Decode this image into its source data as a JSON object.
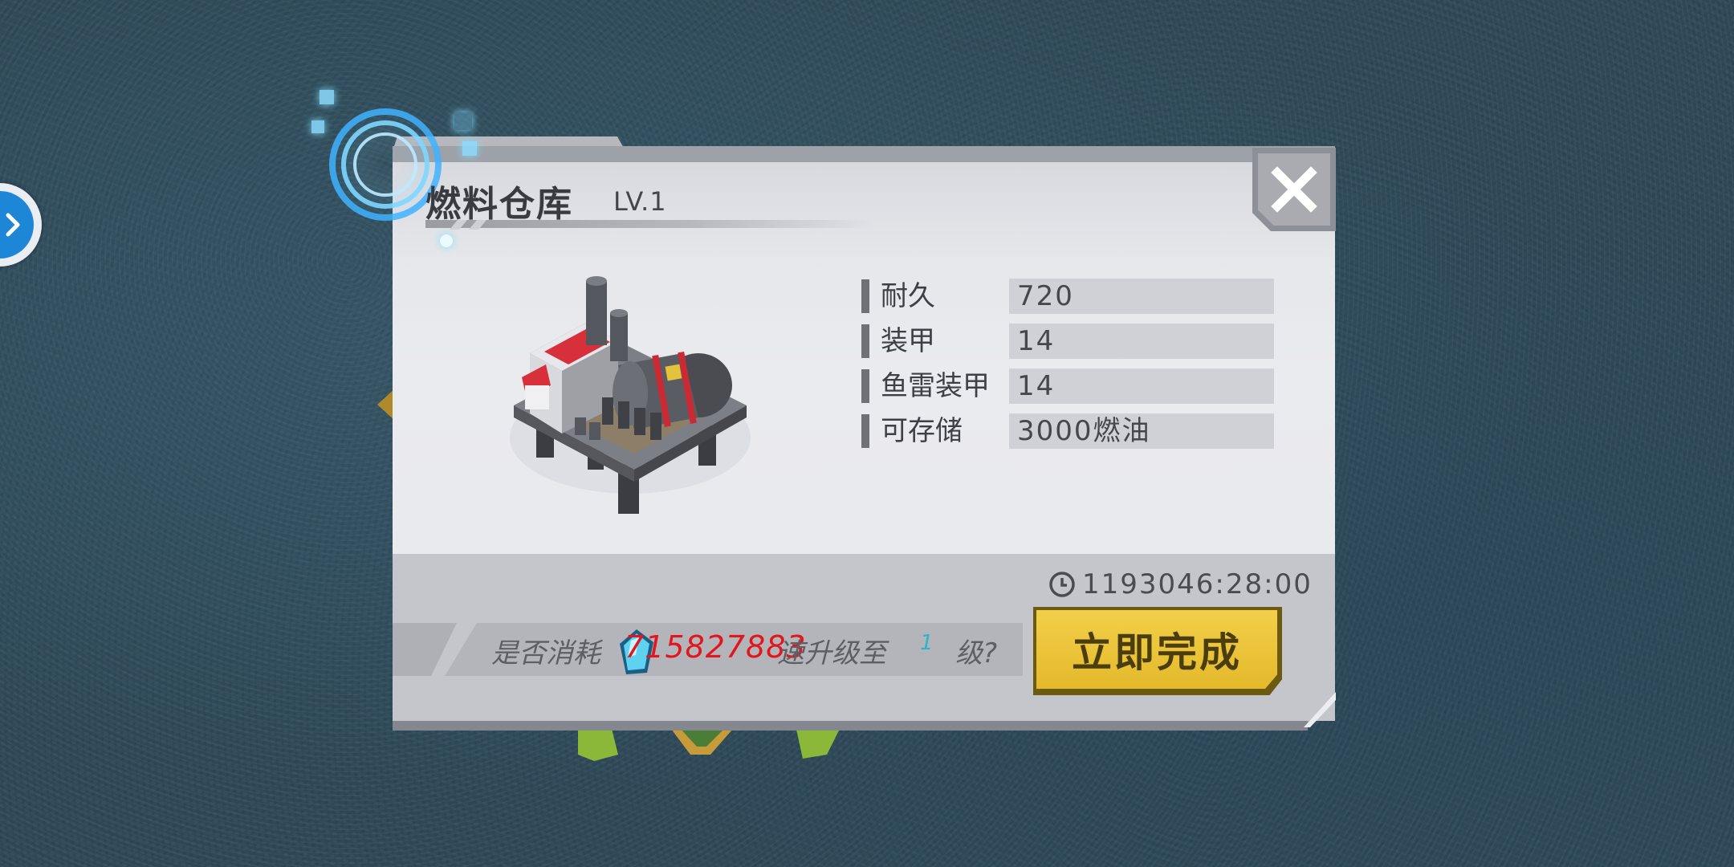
{
  "building": {
    "name": "燃料仓库",
    "level": "LV.1"
  },
  "stats": [
    {
      "label": "耐久",
      "value": "720"
    },
    {
      "label": "装甲",
      "value": "14"
    },
    {
      "label": "鱼雷装甲",
      "value": "14"
    },
    {
      "label": "可存储",
      "value": "3000燃油"
    }
  ],
  "timer": {
    "icon": "clock-icon",
    "value": "1193046:28:00"
  },
  "confirm": {
    "prefix": "是否消耗",
    "cost": "715827883",
    "middle": "速升级至",
    "target_level": "1",
    "suffix": "级?"
  },
  "actions": {
    "finish_label": "立即完成",
    "close_icon": "close-icon",
    "side_icon": "chevron-right-icon"
  },
  "colors": {
    "cost_red": "#e0171d",
    "button_yellow": "#f2d04a",
    "side_button_blue": "#1e86d6"
  }
}
